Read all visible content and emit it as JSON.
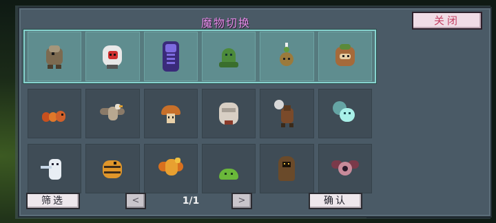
{
  "dialog": {
    "title": "魔物切换",
    "close_label": "关闭",
    "filter_label": "筛选",
    "confirm_label": "确认",
    "page_indicator": "1/1",
    "prev_glyph": "<",
    "next_glyph": ">"
  },
  "monsters": {
    "rows": [
      [
        "rock-beast",
        "red-face-spirit",
        "shadow-skeleton",
        "green-ghost",
        "onion-sprout",
        "raccoon"
      ],
      [
        "caterpillar",
        "eagle",
        "mushroom",
        "rock-golem",
        "axe-minotaur",
        "wisp"
      ],
      [
        "white-cat-knight",
        "tiger-cub",
        "phoenix",
        "green-slime",
        "hooded-monk",
        "bat-eye"
      ]
    ]
  },
  "colors": {
    "title": "#e28be6",
    "close_text": "#c33f62",
    "selected_row_border": "#86d3cf"
  }
}
